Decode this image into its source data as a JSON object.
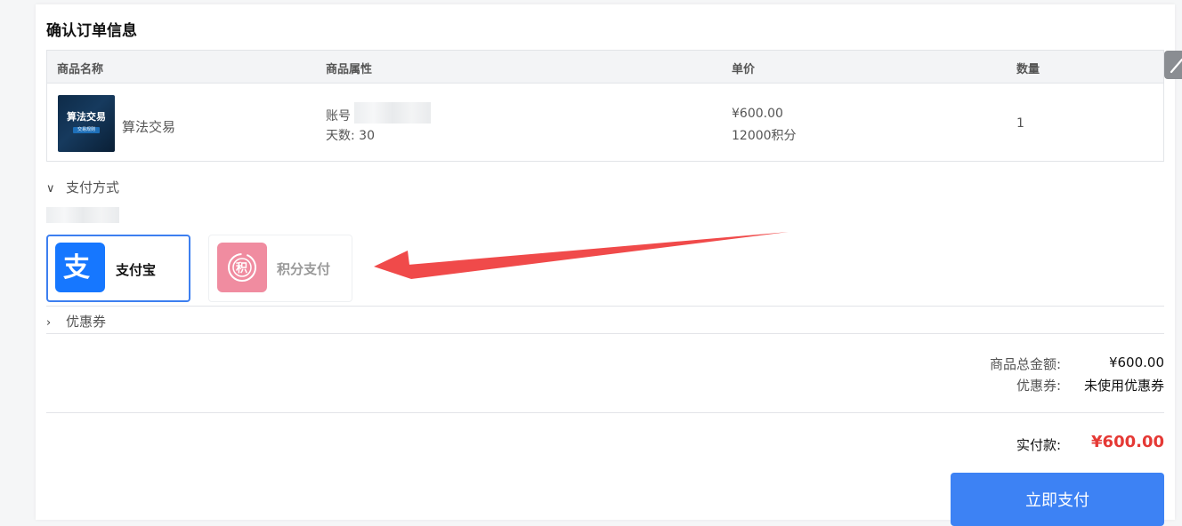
{
  "page": {
    "title": "确认订单信息"
  },
  "table": {
    "headers": [
      "商品名称",
      "商品属性",
      "单价",
      "数量"
    ],
    "row": {
      "thumb_title": "算法交易",
      "thumb_sub": "交易规则",
      "product_name": "算法交易",
      "attr_account_label": "账号",
      "attr_days": "天数: 30",
      "price": "¥600.00",
      "points": "12000积分",
      "quantity": "1"
    }
  },
  "payment": {
    "section_title": "支付方式",
    "options": [
      {
        "label": "支付宝",
        "icon": "alipay-icon",
        "selected": true,
        "color": "#1677ff"
      },
      {
        "label": "积分支付",
        "icon": "points-icon",
        "selected": false,
        "color": "#f08ca0"
      }
    ]
  },
  "coupon": {
    "section_title": "优惠券"
  },
  "summary": {
    "total_label": "商品总金额:",
    "total_value": "¥600.00",
    "coupon_label": "优惠券:",
    "coupon_value": "未使用优惠券",
    "actual_label": "实付款:",
    "actual_value": "¥600.00",
    "actual_color": "#e53935"
  },
  "actions": {
    "pay_button": "立即支付"
  },
  "colors": {
    "accent": "#3d82f4",
    "arrow": "#f04a4a"
  }
}
